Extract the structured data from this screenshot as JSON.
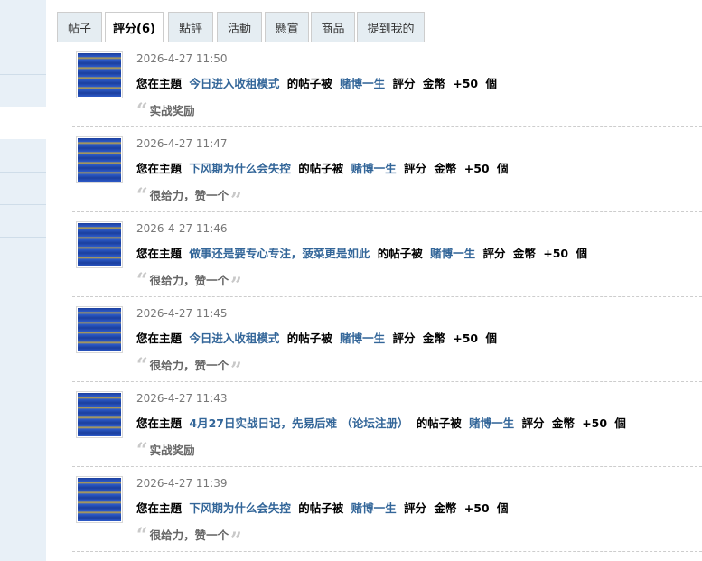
{
  "tabs": [
    {
      "label": "帖子",
      "active": false
    },
    {
      "label": "評分(6)",
      "active": true
    },
    {
      "label": "點評",
      "active": false
    },
    {
      "label": "活動",
      "active": false
    },
    {
      "label": "懸賞",
      "active": false
    },
    {
      "label": "商品",
      "active": false
    },
    {
      "label": "提到我的",
      "active": false
    }
  ],
  "text": {
    "prefix": "您在主題",
    "mid": "的帖子被",
    "rate": "評分",
    "currency": "金幣",
    "amount": "+50",
    "unit": "個"
  },
  "ratings": [
    {
      "time": "2026-4-27 11:50",
      "topic": "今日进入收租模式",
      "user": "赌博一生",
      "reason": "实战奖励"
    },
    {
      "time": "2026-4-27 11:47",
      "topic": "下风期为什么会失控",
      "user": "赌博一生",
      "reason": "很给力，赞一个"
    },
    {
      "time": "2026-4-27 11:46",
      "topic": "做事还是要专心专注，菠菜更是如此",
      "user": "赌博一生",
      "reason": "很给力，赞一个"
    },
    {
      "time": "2026-4-27 11:45",
      "topic": "今日进入收租模式",
      "user": "赌博一生",
      "reason": "很给力，赞一个"
    },
    {
      "time": "2026-4-27 11:43",
      "topic": "4月27日实战日记，先易后难 （论坛注册）",
      "user": "赌博一生",
      "reason": "实战奖励"
    },
    {
      "time": "2026-4-27 11:39",
      "topic": "下风期为什么会失控",
      "user": "赌博一生",
      "reason": "很给力，赞一个"
    }
  ],
  "colors": {
    "link": "#336699",
    "tab_bg": "#e5edf2",
    "sidebar_bg": "#e8f0f7"
  }
}
